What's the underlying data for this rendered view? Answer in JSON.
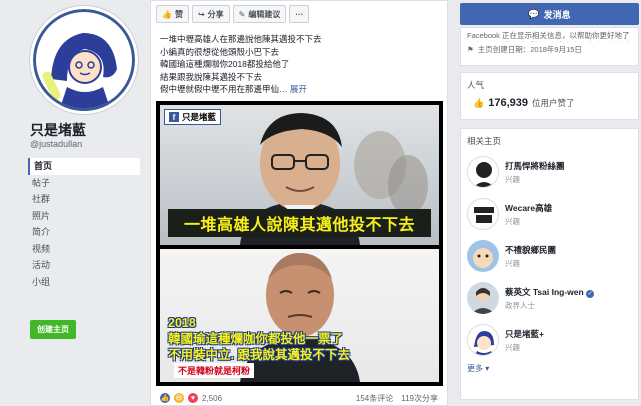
{
  "page": {
    "name": "只是堵藍",
    "handle": "@justadullan",
    "nav": [
      "首页",
      "帖子",
      "社群",
      "照片",
      "简介",
      "视频",
      "活动",
      "小组"
    ],
    "create_page": "创建主页"
  },
  "post": {
    "toolbar": {
      "like": "赞",
      "share": "分享",
      "edit": "编辑建议",
      "more": "···"
    },
    "lines": [
      "一堆中壢高雄人在那邊說他陳其邁投不下去",
      "小編真的很想從他頭殼小巴下去",
      "韓國瑜這種爛咖你2018都投給他了",
      "結果跟我說陳其邁投不下去",
      "假中壢就假中壢不用在那邊甲仙…"
    ],
    "see_more": "展开",
    "image": {
      "tag": "只是堵藍",
      "caption1": "一堆高雄人說陳其邁他投不下去",
      "caption2_line1": "2018",
      "caption2_line2": "韓國瑜這種爛咖你都投他一票了",
      "caption2_line3": "不用裝中立. 跟我說其邁投不下去",
      "caption3": "不是韓粉就是柯粉"
    },
    "reaction_count": "2,506",
    "comments": "154条评论",
    "shares": "119次分享"
  },
  "sidebar": {
    "message_button": "发消息",
    "info_partial": "Facebook 正在显示相关信息，以帮助你更好地了解主页的目的。查看管理和发布内容的人员的操作记录。",
    "created": "主页创建日期：2018年9月15日",
    "likes_title": "人气",
    "likes_count": "176,939",
    "likes_label": "位用户赞了",
    "related_title": "相关主页",
    "related": [
      {
        "name": "打馬悍將粉絲團",
        "sub": "兴趣"
      },
      {
        "name": "Wecare高雄",
        "sub": "兴趣"
      },
      {
        "name": "不禮貌鄉民團",
        "sub": "兴趣"
      },
      {
        "name": "蔡英文 Tsai Ing-wen",
        "sub": "政界人士"
      },
      {
        "name": "只是堵藍+",
        "sub": "兴趣"
      }
    ],
    "more": "更多"
  },
  "colors": {
    "facebook_blue": "#4267b2",
    "create_green": "#42b72a",
    "caption_yellow": "#f7f01b"
  }
}
